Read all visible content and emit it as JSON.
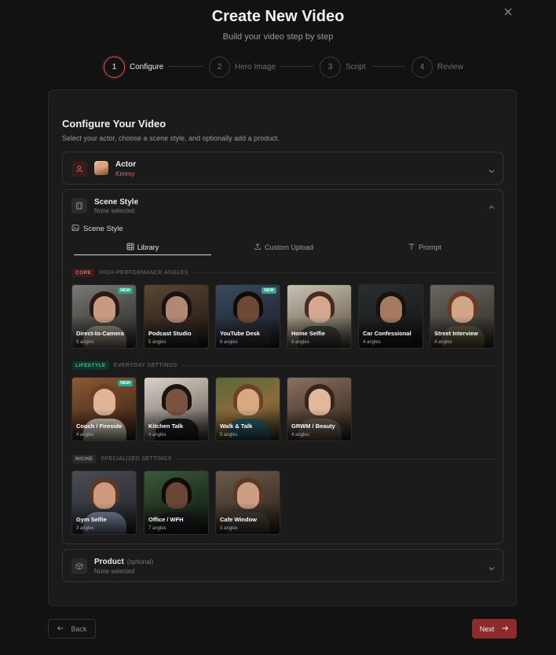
{
  "header": {
    "title": "Create New Video",
    "subtitle": "Build your video step by step"
  },
  "steps": [
    {
      "num": "1",
      "label": "Configure",
      "active": true
    },
    {
      "num": "2",
      "label": "Hero Image",
      "active": false
    },
    {
      "num": "3",
      "label": "Script",
      "active": false
    },
    {
      "num": "4",
      "label": "Review",
      "active": false
    }
  ],
  "panel": {
    "title": "Configure Your Video",
    "subtitle": "Select your actor, choose a scene style, and optionally add a product."
  },
  "actor": {
    "title": "Actor",
    "value": "Kimmy"
  },
  "scene": {
    "title": "Scene Style",
    "value": "None selected",
    "field_label": "Scene Style",
    "tabs": [
      "Library",
      "Custom Upload",
      "Prompt"
    ],
    "sections": [
      {
        "badge": "CORE",
        "label": "HIGH-PERFORMANCE ANGLES",
        "items": [
          {
            "name": "Direct-to-Camera",
            "angles": "5 angles",
            "new": "NEW"
          },
          {
            "name": "Podcast Studio",
            "angles": "5 angles",
            "new": ""
          },
          {
            "name": "YouTube Desk",
            "angles": "6 angles",
            "new": "NEW"
          },
          {
            "name": "Home Selfie",
            "angles": "8 angles",
            "new": ""
          },
          {
            "name": "Car Confessional",
            "angles": "4 angles",
            "new": ""
          },
          {
            "name": "Street Interview",
            "angles": "4 angles",
            "new": ""
          }
        ]
      },
      {
        "badge": "LIFESTYLE",
        "label": "EVERYDAY SETTINGS",
        "items": [
          {
            "name": "Couch / Fireside",
            "angles": "4 angles",
            "new": "NEW"
          },
          {
            "name": "Kitchen Talk",
            "angles": "4 angles",
            "new": ""
          },
          {
            "name": "Walk & Talk",
            "angles": "5 angles",
            "new": ""
          },
          {
            "name": "GRWM / Beauty",
            "angles": "4 angles",
            "new": ""
          }
        ]
      },
      {
        "badge": "NICHE",
        "label": "SPECIALIZED SETTINGS",
        "items": [
          {
            "name": "Gym Selfie",
            "angles": "3 angles",
            "new": ""
          },
          {
            "name": "Office / WFH",
            "angles": "7 angles",
            "new": ""
          },
          {
            "name": "Cafe Window",
            "angles": "3 angles",
            "new": ""
          }
        ]
      }
    ]
  },
  "product": {
    "title": "Product",
    "optional": "(optional)",
    "value": "None selected"
  },
  "footer": {
    "back": "Back",
    "next": "Next"
  },
  "colors": {
    "accent": "#d9534f",
    "next_button": "#8f2a2c",
    "new_badge": "#2aa889"
  }
}
